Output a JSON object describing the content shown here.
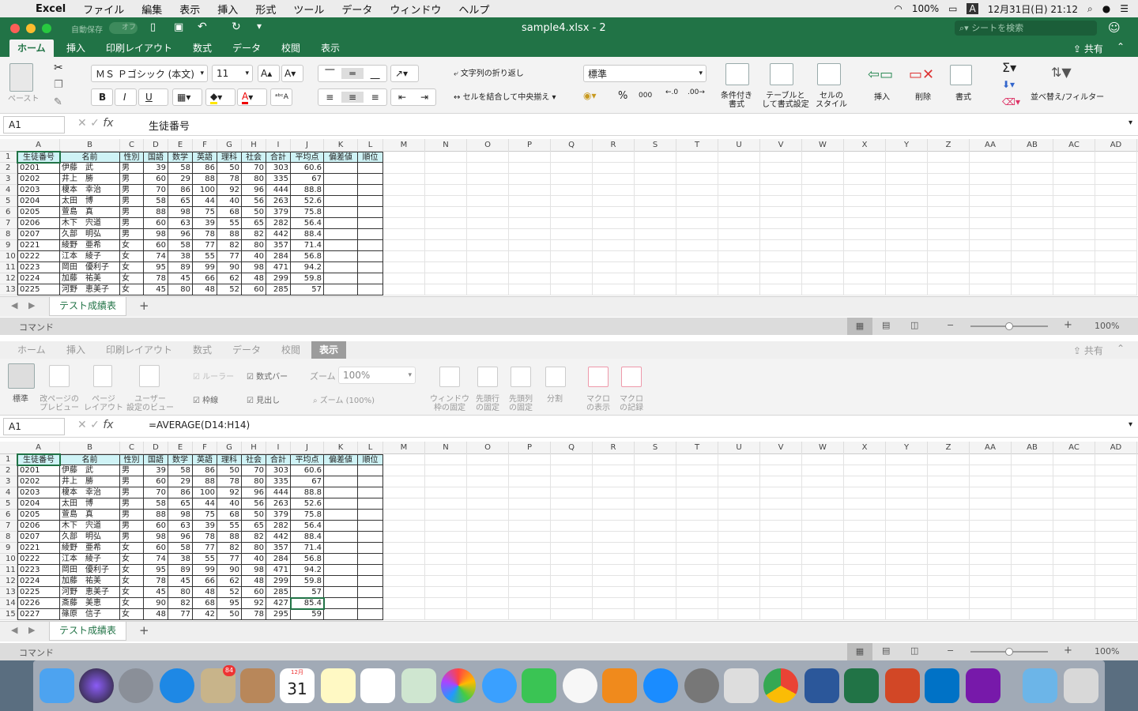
{
  "menubar": {
    "app": "Excel",
    "items": [
      "ファイル",
      "編集",
      "表示",
      "挿入",
      "形式",
      "ツール",
      "データ",
      "ウィンドウ",
      "ヘルプ"
    ],
    "battery": "100%",
    "input": "A",
    "datetime": "12月31日(日)  21:12"
  },
  "window": {
    "title": "sample4.xlsx  -  2",
    "autosave": "自動保存",
    "autosave_state": "オフ",
    "search_placeholder": "シートを検索",
    "share": "共有"
  },
  "tabs": [
    "ホーム",
    "挿入",
    "印刷レイアウト",
    "数式",
    "データ",
    "校閲",
    "表示"
  ],
  "home_ribbon": {
    "paste": "ペースト",
    "font_name": "ＭＳ Ｐゴシック (本文)",
    "font_size": "11",
    "bold": "B",
    "italic": "I",
    "underline": "U",
    "wrap_text": "文字列の折り返し",
    "merge_center": "セルを結合して中央揃え",
    "number_format": "標準",
    "percent": "%",
    "comma": "000",
    "cond_format": "条件付き\n書式",
    "table_format": "テーブルと\nして書式設定",
    "cell_style": "セルの\nスタイル",
    "insert": "挿入",
    "delete": "削除",
    "format": "書式",
    "sort_filter": "並べ替え/フィルター"
  },
  "view_ribbon": {
    "normal": "標準",
    "page_break": "改ページの\nプレビュー",
    "page_layout": "ページ\nレイアウト",
    "custom_view": "ユーザー\n設定のビュー",
    "ruler": "ルーラー",
    "formula_bar": "数式バー",
    "gridlines": "枠線",
    "headings": "見出し",
    "zoom_label": "ズーム",
    "zoom_value": "100%",
    "zoom_100": "ズーム (100%)",
    "freeze": "ウィンドウ\n枠の固定",
    "freeze_row": "先頭行\nの固定",
    "freeze_col": "先頭列\nの固定",
    "split": "分割",
    "macro_show": "マクロ\nの表示",
    "macro_record": "マクロ\nの記録"
  },
  "pane1": {
    "cell_ref": "A1",
    "formula": "生徒番号"
  },
  "pane2": {
    "cell_ref": "A1",
    "formula": "=AVERAGE(D14:H14)"
  },
  "columns": [
    "A",
    "B",
    "C",
    "D",
    "E",
    "F",
    "G",
    "H",
    "I",
    "J",
    "K",
    "L",
    "M",
    "N",
    "O",
    "P",
    "Q",
    "R",
    "S",
    "T",
    "U",
    "V",
    "W",
    "X",
    "Y",
    "Z",
    "AA",
    "AB",
    "AC",
    "AD"
  ],
  "headers": [
    "生徒番号",
    "名前",
    "性別",
    "国語",
    "数学",
    "英語",
    "理科",
    "社会",
    "合計",
    "平均点",
    "偏差値",
    "順位"
  ],
  "rows": [
    [
      "0201",
      "伊藤　武",
      "男",
      "39",
      "58",
      "86",
      "50",
      "70",
      "303",
      "60.6"
    ],
    [
      "0202",
      "井上　勝",
      "男",
      "60",
      "29",
      "88",
      "78",
      "80",
      "335",
      "67"
    ],
    [
      "0203",
      "榎本　幸治",
      "男",
      "70",
      "86",
      "100",
      "92",
      "96",
      "444",
      "88.8"
    ],
    [
      "0204",
      "太田　博",
      "男",
      "58",
      "65",
      "44",
      "40",
      "56",
      "263",
      "52.6"
    ],
    [
      "0205",
      "萱島　真",
      "男",
      "88",
      "98",
      "75",
      "68",
      "50",
      "379",
      "75.8"
    ],
    [
      "0206",
      "木下　宍道",
      "男",
      "60",
      "63",
      "39",
      "55",
      "65",
      "282",
      "56.4"
    ],
    [
      "0207",
      "久部　明弘",
      "男",
      "98",
      "96",
      "78",
      "88",
      "82",
      "442",
      "88.4"
    ],
    [
      "0221",
      "綾野　亜希",
      "女",
      "60",
      "58",
      "77",
      "82",
      "80",
      "357",
      "71.4"
    ],
    [
      "0222",
      "江本　綾子",
      "女",
      "74",
      "38",
      "55",
      "77",
      "40",
      "284",
      "56.8"
    ],
    [
      "0223",
      "岡田　優利子",
      "女",
      "95",
      "89",
      "99",
      "90",
      "98",
      "471",
      "94.2"
    ],
    [
      "0224",
      "加藤　祐美",
      "女",
      "78",
      "45",
      "66",
      "62",
      "48",
      "299",
      "59.8"
    ],
    [
      "0225",
      "河野　恵美子",
      "女",
      "45",
      "80",
      "48",
      "52",
      "60",
      "285",
      "57"
    ],
    [
      "0226",
      "斎藤　美恵",
      "女",
      "90",
      "82",
      "68",
      "95",
      "92",
      "427",
      "85.4"
    ],
    [
      "0227",
      "篠原　信子",
      "女",
      "48",
      "77",
      "42",
      "50",
      "78",
      "295",
      "59"
    ]
  ],
  "sheet_tab": "テスト成績表",
  "status": {
    "mode": "コマンド",
    "zoom": "100%"
  },
  "dock": {
    "mail_badge": "84",
    "calendar_month": "12月",
    "calendar_day": "31"
  },
  "colors": {
    "excel_green": "#217346",
    "header_fill": "#cff3f6"
  }
}
